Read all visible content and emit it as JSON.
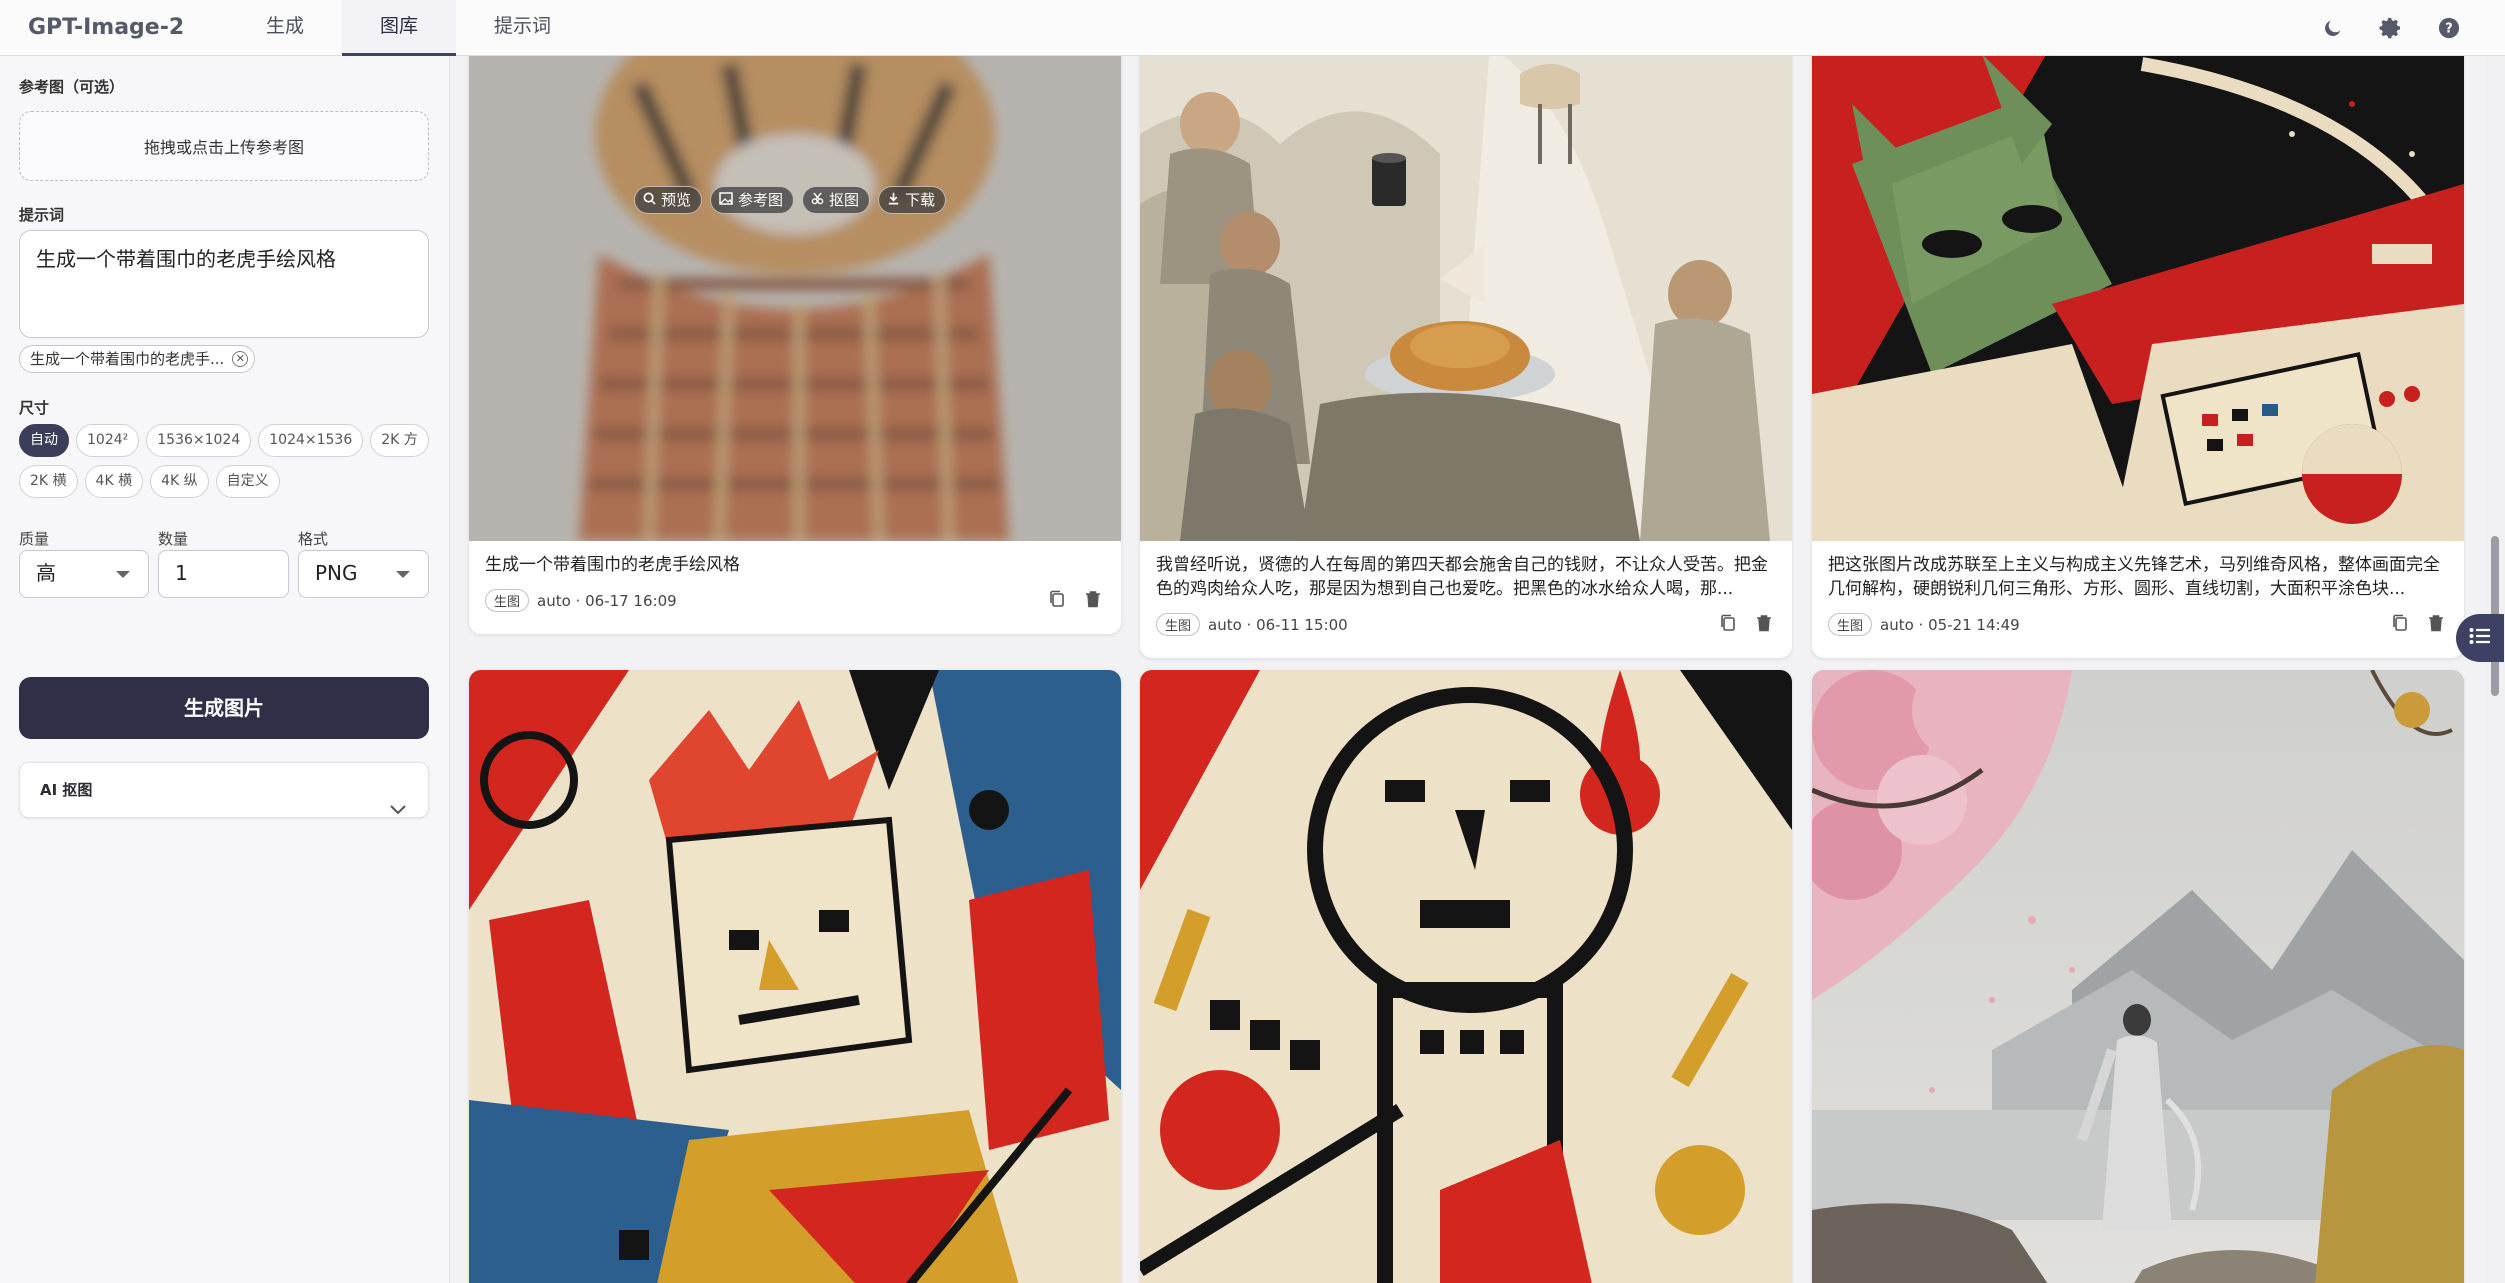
{
  "app": {
    "title": "GPT-Image-2"
  },
  "tabs": [
    {
      "label": "生成"
    },
    {
      "label": "图库"
    },
    {
      "label": "提示词"
    }
  ],
  "top_icons": [
    "moon-icon",
    "gear-icon",
    "help-icon"
  ],
  "sidebar": {
    "ref_label": "参考图（可选）",
    "upload_text": "拖拽或点击上传参考图",
    "prompt_label": "提示词",
    "prompt_value": "生成一个带着围巾的老虎手绘风格",
    "prompt_chip": "生成一个带着围巾的老虎手...",
    "size_label": "尺寸",
    "sizes_row1": [
      "自动",
      "1024²",
      "1536×1024",
      "1024×1536",
      "2K 方"
    ],
    "sizes_row2": [
      "2K 横",
      "4K 横",
      "4K 纵",
      "自定义"
    ],
    "selected_size": "自动",
    "quality_label": "质量",
    "quality_value": "高",
    "count_label": "数量",
    "count_value": "1",
    "format_label": "格式",
    "format_value": "PNG",
    "generate_label": "生成图片",
    "ai_panel_label": "AI 抠图"
  },
  "overlay": {
    "preview": "预览",
    "reference": "参考图",
    "cutout": "抠图",
    "download": "下载"
  },
  "cards": [
    {
      "caption": "生成一个带着围巾的老虎手绘风格",
      "badge": "生图",
      "meta": "auto · 06-17 16:09"
    },
    {
      "caption": "我曾经听说，贤德的人在每周的第四天都会施舍自己的钱财，不让众人受苦。把金色的鸡肉给众人吃，那是因为想到自己也爱吃。把黑色的冰水给众人喝，那...",
      "badge": "生图",
      "meta": "auto · 06-11 15:00"
    },
    {
      "caption": "把这张图片改成苏联至上主义与构成主义先锋艺术，马列维奇风格，整体画面完全几何解构，硬朗锐利几何三角形、方形、圆形、直线切割，大面积平涂色块...",
      "badge": "生图",
      "meta": "auto · 05-21 14:49"
    }
  ],
  "colors": {
    "accent": "#2f3048",
    "active_chip": "#3b3e58"
  }
}
